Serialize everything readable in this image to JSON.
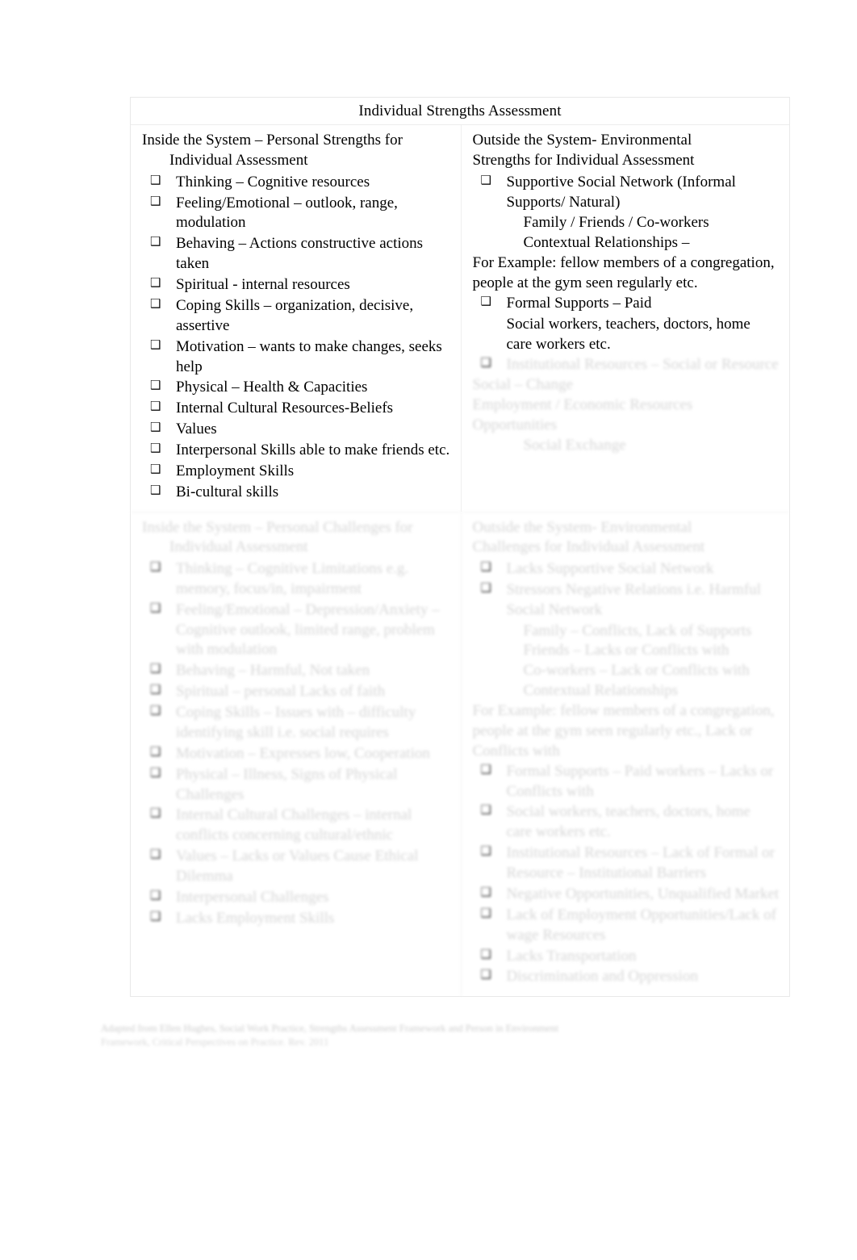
{
  "document": {
    "title": "Individual Strengths Assessment",
    "bullet_glyph": "❑"
  },
  "strengths": {
    "left": {
      "heading_line1": "Inside the System – Personal Strengths for",
      "heading_line2": "Individual Assessment",
      "items": [
        "Thinking – Cognitive resources",
        "Feeling/Emotional – outlook, range, modulation",
        "Behaving – Actions constructive actions taken",
        "Spiritual - internal resources",
        "Coping Skills – organization, decisive, assertive",
        "Motivation – wants to make changes, seeks help",
        "Physical – Health & Capacities",
        "Internal Cultural Resources-Beliefs",
        "Values",
        "Interpersonal Skills able to make friends etc.",
        "Employment Skills",
        "Bi-cultural skills"
      ]
    },
    "right": {
      "heading_line1": "Outside the System- Environmental",
      "heading_line2": "Strengths for Individual Assessment",
      "item1": "Supportive Social Network (Informal Supports/ Natural)",
      "item1_sub1": "Family / Friends / Co-workers",
      "item1_sub2": "Contextual Relationships –",
      "example_text": "For Example: fellow members of a congregation, people at the gym seen regularly etc.",
      "item2": "Formal Supports – Paid",
      "item2_sub": "Social workers, teachers, doctors, home care workers etc.",
      "ghost_items": [
        "Institutional Resources – Social or Resource",
        "Social – Change",
        "Employment / Economic Resources",
        "Opportunities",
        "Social Exchange"
      ]
    }
  },
  "challenges": {
    "left": {
      "heading_line1": "Inside the System – Personal Challenges for",
      "heading_line2": "Individual Assessment",
      "items": [
        "Thinking – Cognitive Limitations e.g. memory, focus/in, impairment",
        "Feeling/Emotional – Depression/Anxiety – Cognitive outlook, limited range, problem with modulation",
        "Behaving – Harmful, Not taken",
        "Spiritual – personal Lacks of faith",
        "Coping Skills – Issues with – difficulty identifying skill i.e. social requires",
        "Motivation – Expresses low, Cooperation",
        "Physical – Illness, Signs of Physical Challenges",
        "Internal Cultural Challenges – internal conflicts concerning cultural/ethnic",
        "Values – Lacks or Values Cause Ethical Dilemma",
        "Interpersonal Challenges",
        "Lacks Employment Skills"
      ]
    },
    "right": {
      "heading_line1": "Outside the System- Environmental",
      "heading_line2": "Challenges for Individual Assessment",
      "items": [
        "Lacks Supportive Social Network",
        "Stressors Negative Relations i.e. Harmful Social Network",
        "Family – Conflicts, Lack of Supports",
        "Friends – Lacks or Conflicts with",
        "Co-workers – Lack or Conflicts with",
        "Contextual Relationships"
      ],
      "example_text": "For Example: fellow members of a congregation, people at the gym seen regularly etc., Lack or Conflicts with",
      "items2": [
        "Formal Supports – Paid workers – Lacks or Conflicts with",
        "Social workers, teachers, doctors, home care workers etc.",
        "Institutional Resources – Lack of Formal or Resource – Institutional Barriers",
        "Negative Opportunities, Unqualified Market",
        "Lack of Employment Opportunities/Lack of wage Resources",
        "Lacks Transportation",
        "Discrimination and Oppression"
      ]
    }
  },
  "footer": {
    "line1": "Adapted from Ellen Hughes, Social Work Practice, Strengths Assessment Framework and Person in Environment",
    "line2": "Framework, Critical Perspectives on Practice. Rev. 2011"
  }
}
